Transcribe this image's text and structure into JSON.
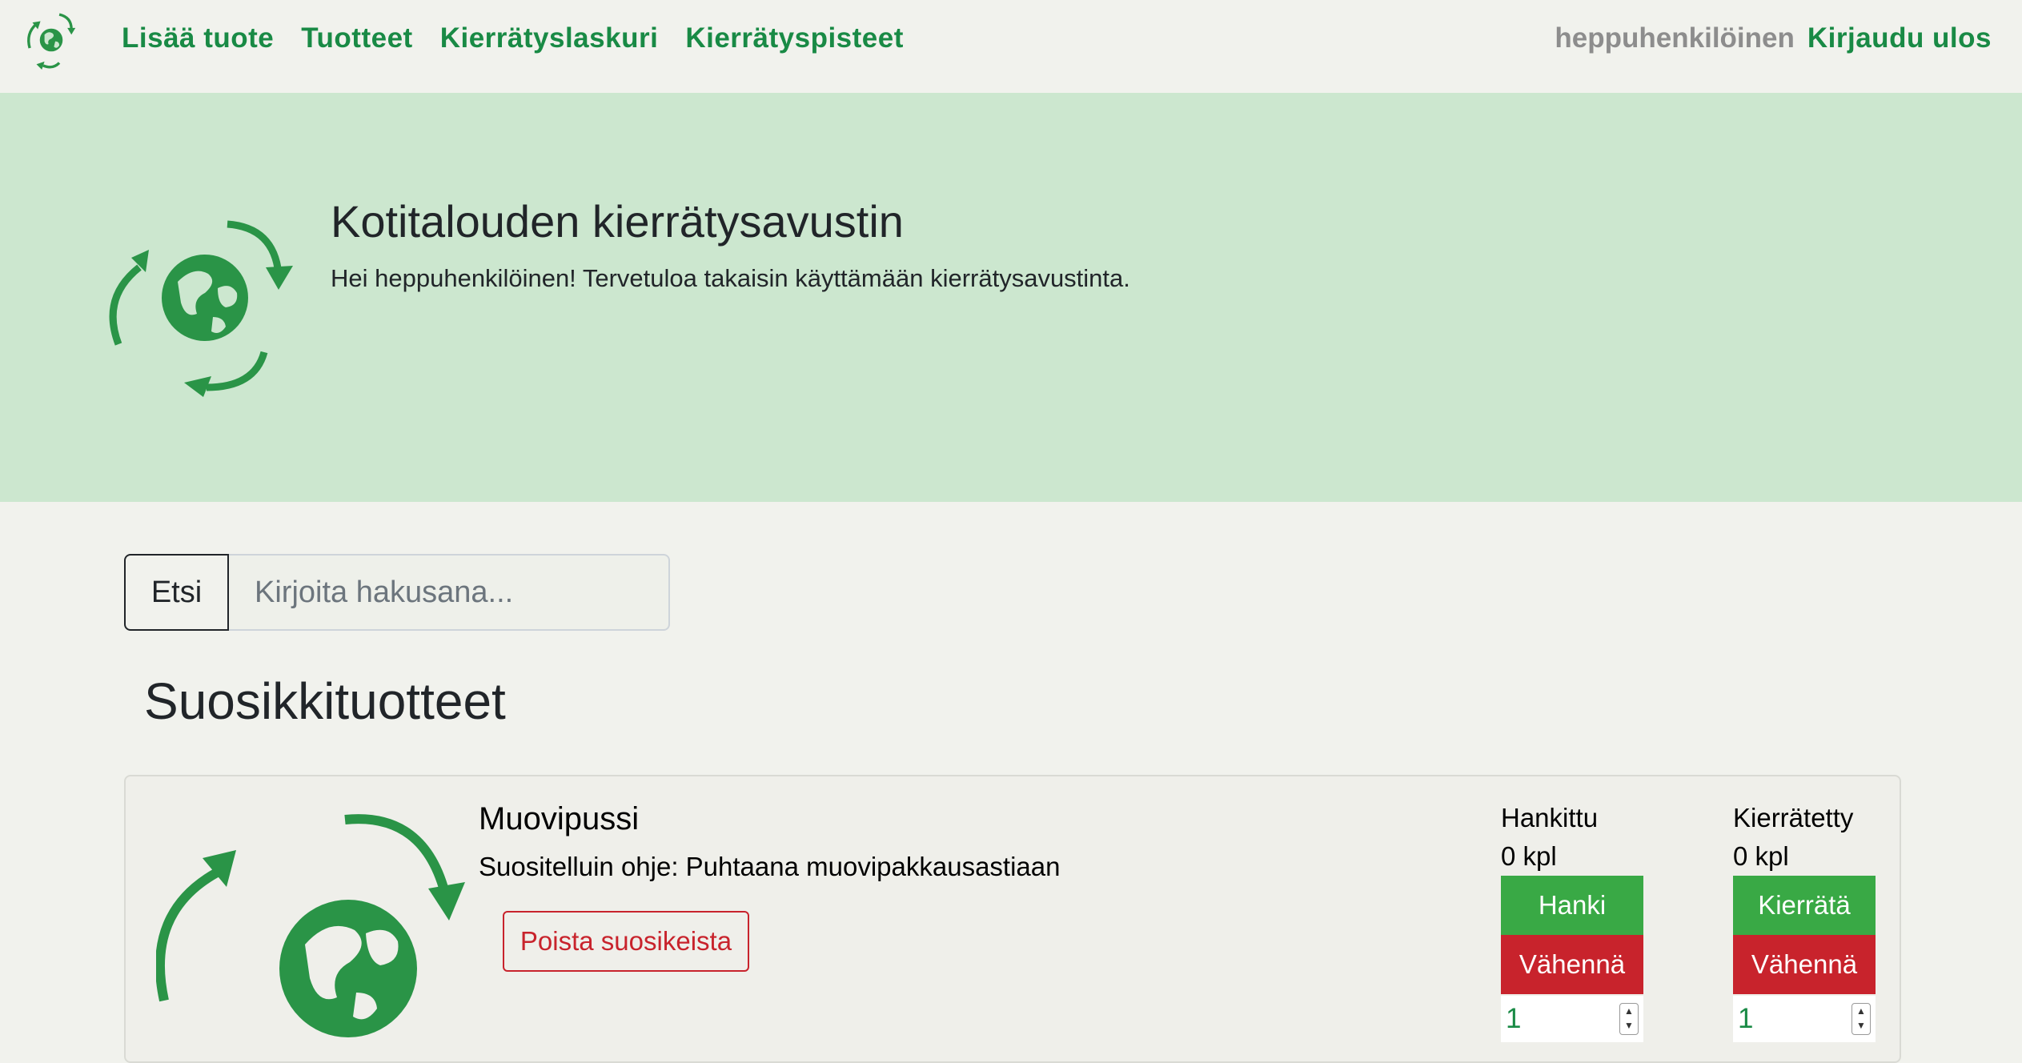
{
  "nav": {
    "links": [
      "Lisää tuote",
      "Tuotteet",
      "Kierrätyslaskuri",
      "Kierrätyspisteet"
    ],
    "username": "heppuhenkilöinen",
    "logout": "Kirjaudu ulos"
  },
  "hero": {
    "title": "Kotitalouden kierrätysavustin",
    "subtitle": "Hei heppuhenkilöinen! Tervetuloa takaisin käyttämään kierrätysavustinta."
  },
  "search": {
    "button": "Etsi",
    "placeholder": "Kirjoita hakusana..."
  },
  "favorites": {
    "title": "Suosikkituotteet",
    "items": [
      {
        "name": "Muovipussi",
        "hint": "Suositelluin ohje: Puhtaana muovipakkausastiaan",
        "remove": "Poista suosikeista",
        "acquired": {
          "label": "Hankittu",
          "count": "0 kpl",
          "add": "Hanki",
          "decrease": "Vähennä",
          "amount": "1"
        },
        "recycled": {
          "label": "Kierrätetty",
          "count": "0 kpl",
          "add": "Kierrätä",
          "decrease": "Vähennä",
          "amount": "1"
        }
      }
    ]
  },
  "colors": {
    "brand_green": "#198a45",
    "hero_bg": "#cce7cf",
    "button_green": "#39a945",
    "button_red": "#c8232c",
    "page_bg": "#f1f2ed"
  }
}
